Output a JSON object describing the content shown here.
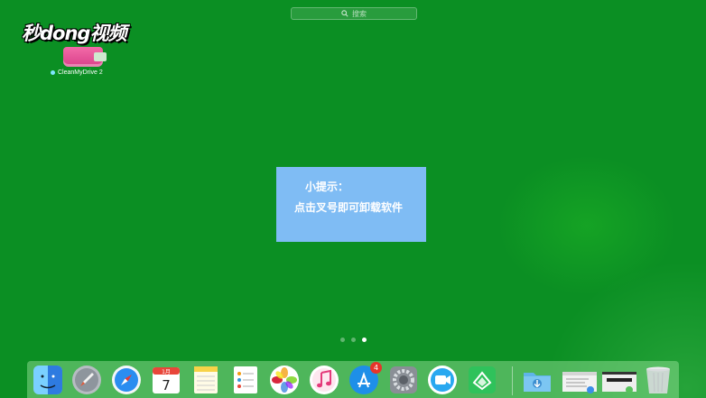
{
  "search": {
    "placeholder": "搜索"
  },
  "watermark": {
    "text": "秒dong视频"
  },
  "desktop": {
    "drive": {
      "label": "CleanMyDrive 2"
    }
  },
  "tip": {
    "title": "小提示：",
    "body": "点击叉号即可卸载软件"
  },
  "pager": {
    "pages": 3,
    "active": 3
  },
  "dock": {
    "items": [
      {
        "name": "Finder",
        "icon": "finder-icon"
      },
      {
        "name": "Launchpad",
        "icon": "rocket-icon"
      },
      {
        "name": "Safari",
        "icon": "compass-icon"
      },
      {
        "name": "Calendar",
        "icon": "calendar-icon",
        "month": "1月",
        "day": "7"
      },
      {
        "name": "Notes",
        "icon": "notes-icon"
      },
      {
        "name": "Reminders",
        "icon": "reminders-icon"
      },
      {
        "name": "Photos",
        "icon": "photos-icon"
      },
      {
        "name": "iTunes",
        "icon": "music-note-icon"
      },
      {
        "name": "App Store",
        "icon": "app-store-icon",
        "badge": "4"
      },
      {
        "name": "System Preferences",
        "icon": "gear-icon"
      },
      {
        "name": "Video App",
        "icon": "video-camera-icon"
      },
      {
        "name": "Green App",
        "icon": "green-chevron-icon"
      },
      {
        "name": "Downloads",
        "icon": "downloads-folder-icon"
      },
      {
        "name": "Document Window",
        "icon": "window-thumbnail-icon"
      },
      {
        "name": "Screen Window",
        "icon": "window-thumbnail-dark-icon"
      },
      {
        "name": "Trash",
        "icon": "trash-icon"
      }
    ]
  },
  "colors": {
    "desktop": "#0b8f23",
    "tip_bg": "#7fbcf4",
    "badge": "#e6342a"
  }
}
